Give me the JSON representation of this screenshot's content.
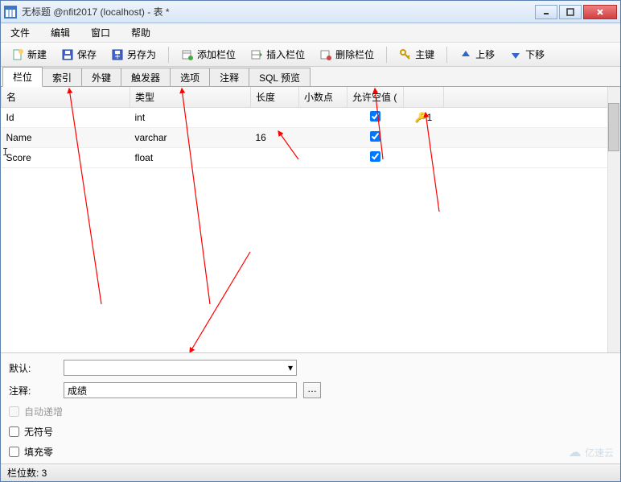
{
  "title": "无标题 @nfit2017 (localhost) - 表 *",
  "menu": {
    "file": "文件",
    "edit": "编辑",
    "window": "窗口",
    "help": "帮助"
  },
  "toolbar": {
    "new": "新建",
    "save": "保存",
    "saveas": "另存为",
    "addfield": "添加栏位",
    "insertfield": "插入栏位",
    "delfield": "删除栏位",
    "pk": "主键",
    "up": "上移",
    "down": "下移"
  },
  "tabs": {
    "fields": "栏位",
    "indexes": "索引",
    "fk": "外键",
    "triggers": "触发器",
    "options": "选项",
    "comment": "注释",
    "sqlpreview": "SQL 预览"
  },
  "grid": {
    "headers": {
      "name": "名",
      "type": "类型",
      "length": "长度",
      "decimals": "小数点",
      "nullable": "允许空值 (",
      "key": ""
    },
    "rows": [
      {
        "name": "Id",
        "type": "int",
        "length": "",
        "decimals": "",
        "null": true,
        "key": "1"
      },
      {
        "name": "Name",
        "type": "varchar",
        "length": "16",
        "decimals": "",
        "null": true,
        "key": ""
      },
      {
        "name": "Score",
        "type": "float",
        "length": "",
        "decimals": "",
        "null": true,
        "key": ""
      }
    ]
  },
  "form": {
    "default_label": "默认:",
    "default_value": "",
    "comment_label": "注释:",
    "comment_value": "成绩",
    "autoinc": "自动递增",
    "unsigned": "无符号",
    "zerofill": "填充零"
  },
  "status": {
    "fieldcount": "栏位数: 3"
  },
  "watermark": "亿速云"
}
